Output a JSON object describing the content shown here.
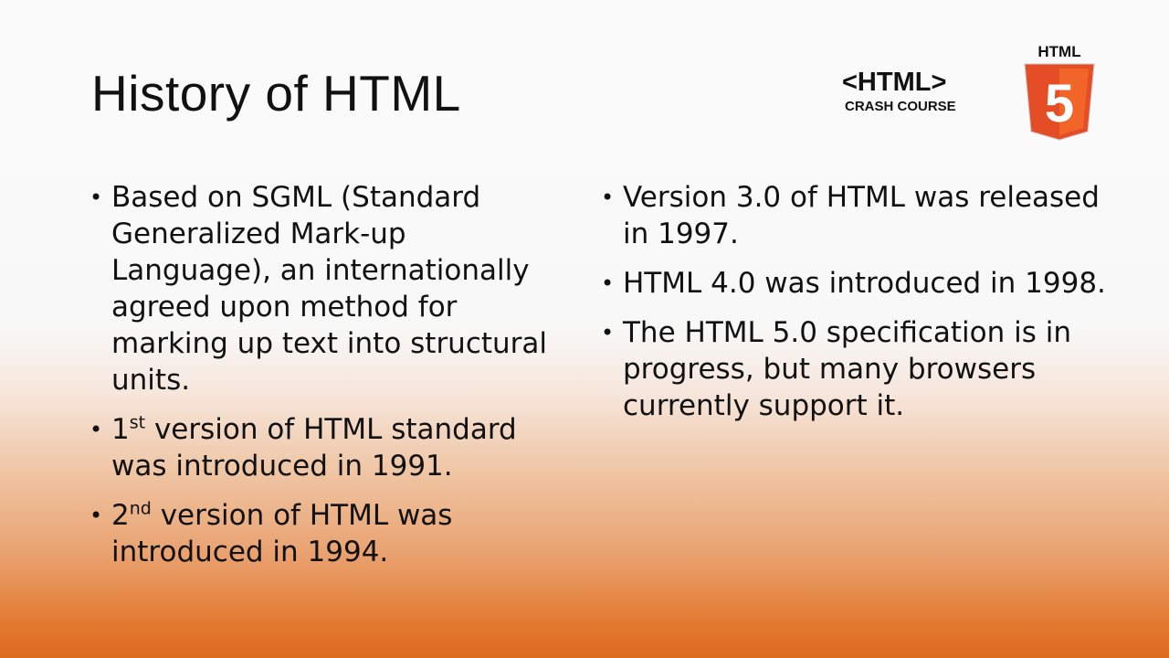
{
  "slide": {
    "title": "History of HTML",
    "logo": {
      "main": "<HTML>",
      "sub": "CRASH COURSE",
      "badge_label": "HTML",
      "badge_number": "5"
    },
    "left_bullets": [
      {
        "text": "Based on SGML (Standard Generalized Mark-up Language), an internationally agreed upon method for marking up text into structural units."
      },
      {
        "pre": "1",
        "sup": "st",
        "post": " version of HTML standard was introduced in 1991."
      },
      {
        "pre": "2",
        "sup": "nd",
        "post": " version of HTML was introduced in 1994."
      }
    ],
    "right_bullets": [
      {
        "text": "Version 3.0 of HTML was released in 1997."
      },
      {
        "text": "HTML 4.0 was introduced in 1998."
      },
      {
        "text": "The HTML 5.0 specification is in progress, but many browsers currently support it."
      }
    ],
    "colors": {
      "accent": "#e44d26",
      "accent_light": "#f16529",
      "text": "#111111"
    }
  }
}
